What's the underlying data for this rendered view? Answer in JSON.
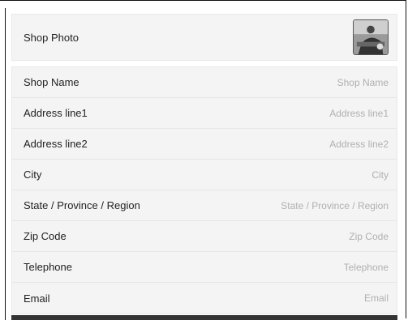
{
  "photo": {
    "label": "Shop Photo",
    "thumbnail_icon": "shop-photo-thumbnail"
  },
  "fields": [
    {
      "label": "Shop Name",
      "placeholder": "Shop Name",
      "value": ""
    },
    {
      "label": "Address line1",
      "placeholder": "Address line1",
      "value": ""
    },
    {
      "label": "Address line2",
      "placeholder": "Address line2",
      "value": ""
    },
    {
      "label": "City",
      "placeholder": "City",
      "value": ""
    },
    {
      "label": "State / Province / Region",
      "placeholder": "State / Province / Region",
      "value": ""
    },
    {
      "label": "Zip Code",
      "placeholder": "Zip Code",
      "value": ""
    },
    {
      "label": "Telephone",
      "placeholder": "Telephone",
      "value": ""
    },
    {
      "label": "Email",
      "placeholder": "Email",
      "value": ""
    }
  ]
}
